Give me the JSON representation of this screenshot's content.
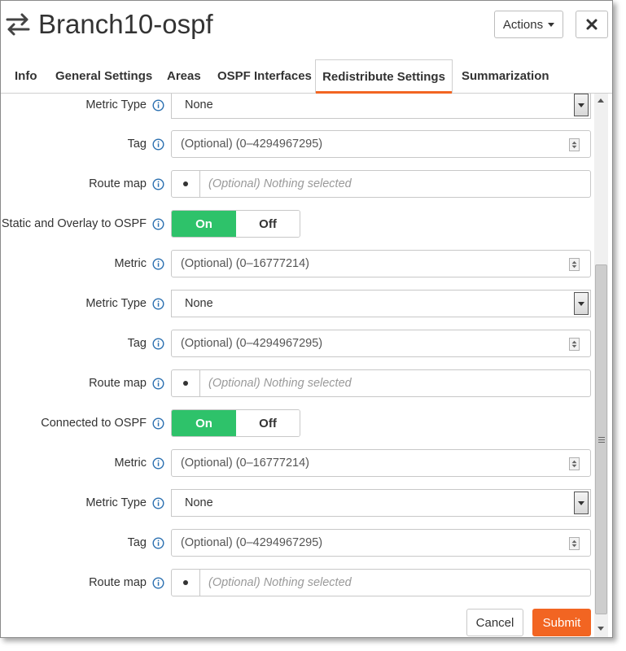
{
  "header": {
    "title": "Branch10-ospf",
    "actions_label": "Actions",
    "close_label": "✕"
  },
  "tabs": [
    {
      "label": "Info"
    },
    {
      "label": "General Settings"
    },
    {
      "label": "Areas"
    },
    {
      "label": "OSPF Interfaces"
    },
    {
      "label": "Redistribute Settings",
      "active": true
    },
    {
      "label": "Summarization"
    }
  ],
  "form": {
    "metric_type_1": {
      "label": "Metric Type",
      "value": "None"
    },
    "tag_1": {
      "label": "Tag",
      "placeholder": "(Optional) (0–4294967295)"
    },
    "route_map_1": {
      "label": "Route map",
      "placeholder": "(Optional) Nothing selected"
    },
    "static_overlay": {
      "label": "Static and Overlay to OSPF",
      "on": "On",
      "off": "Off",
      "state": "On"
    },
    "metric_2": {
      "label": "Metric",
      "placeholder": "(Optional) (0–16777214)"
    },
    "metric_type_2": {
      "label": "Metric Type",
      "value": "None"
    },
    "tag_2": {
      "label": "Tag",
      "placeholder": "(Optional) (0–4294967295)"
    },
    "route_map_2": {
      "label": "Route map",
      "placeholder": "(Optional) Nothing selected"
    },
    "connected": {
      "label": "Connected to OSPF",
      "on": "On",
      "off": "Off",
      "state": "On"
    },
    "metric_3": {
      "label": "Metric",
      "placeholder": "(Optional) (0–16777214)"
    },
    "metric_type_3": {
      "label": "Metric Type",
      "value": "None"
    },
    "tag_3": {
      "label": "Tag",
      "placeholder": "(Optional) (0–4294967295)"
    },
    "route_map_3": {
      "label": "Route map",
      "placeholder": "(Optional) Nothing selected"
    }
  },
  "footer": {
    "cancel_label": "Cancel",
    "submit_label": "Submit"
  },
  "colors": {
    "accent": "#f26522",
    "toggle_on": "#2ec26a",
    "info_icon": "#2a6fb0"
  }
}
